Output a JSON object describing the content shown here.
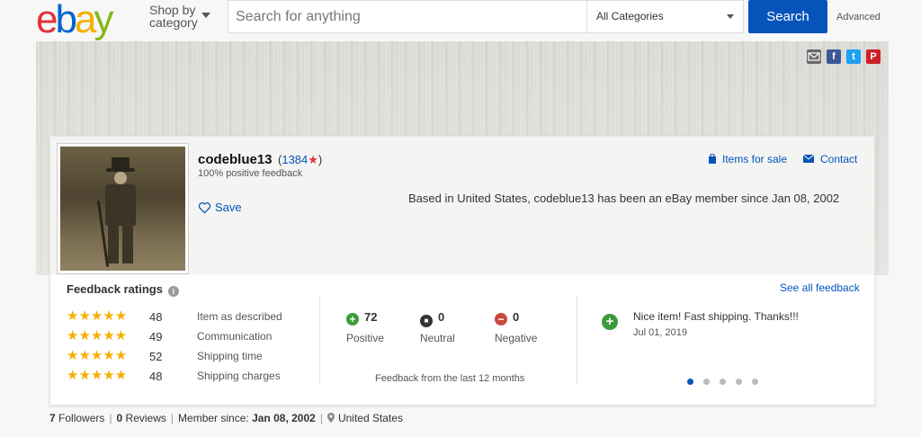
{
  "header": {
    "logo": {
      "e": "e",
      "b": "b",
      "a": "a",
      "y": "y"
    },
    "shop_by_line1": "Shop by",
    "shop_by_line2": "category",
    "search_placeholder": "Search for anything",
    "category_selected": "All Categories",
    "search_button": "Search",
    "advanced": "Advanced"
  },
  "share": {
    "mail": "email-icon",
    "facebook": "f",
    "twitter": "t",
    "pinterest": "P"
  },
  "profile": {
    "username": "codeblue13",
    "score_open": "(",
    "score": "1384",
    "score_star": "★",
    "score_close": ")",
    "positive_feedback": "100% positive feedback",
    "save": "Save",
    "items_for_sale": "Items for sale",
    "contact": "Contact",
    "member_info": "Based in United States, codeblue13 has been an eBay member since Jan 08, 2002"
  },
  "feedback": {
    "title": "Feedback ratings",
    "see_all": "See all feedback",
    "ratings": [
      {
        "stars": "★★★★★",
        "value": "48",
        "label": "Item as described"
      },
      {
        "stars": "★★★★★",
        "value": "49",
        "label": "Communication"
      },
      {
        "stars": "★★★★★",
        "value": "52",
        "label": "Shipping time"
      },
      {
        "stars": "★★★★★",
        "value": "48",
        "label": "Shipping charges"
      }
    ],
    "counts": [
      {
        "icon": "+",
        "value": "72",
        "label": "Positive",
        "color": "#3a9c3a"
      },
      {
        "icon": "■",
        "value": "0",
        "label": "Neutral",
        "color": "#333333"
      },
      {
        "icon": "−",
        "value": "0",
        "label": "Negative",
        "color": "#c8493a"
      }
    ],
    "period": "Feedback from the last 12 months",
    "latest_comment": "Nice item! Fast shipping. Thanks!!!",
    "latest_date": "Jul 01, 2019",
    "carousel_pages": 5,
    "carousel_active": 1
  },
  "stats": {
    "followers_count": "7",
    "followers_label": "Followers",
    "reviews_count": "0",
    "reviews_label": "Reviews",
    "member_since_label": "Member since:",
    "member_since": "Jan 08, 2002",
    "location": "United States",
    "separator": "|"
  },
  "colors": {
    "brand_blue": "#0654ba",
    "star_gold": "#f5af02",
    "positive_green": "#3a9c3a"
  }
}
